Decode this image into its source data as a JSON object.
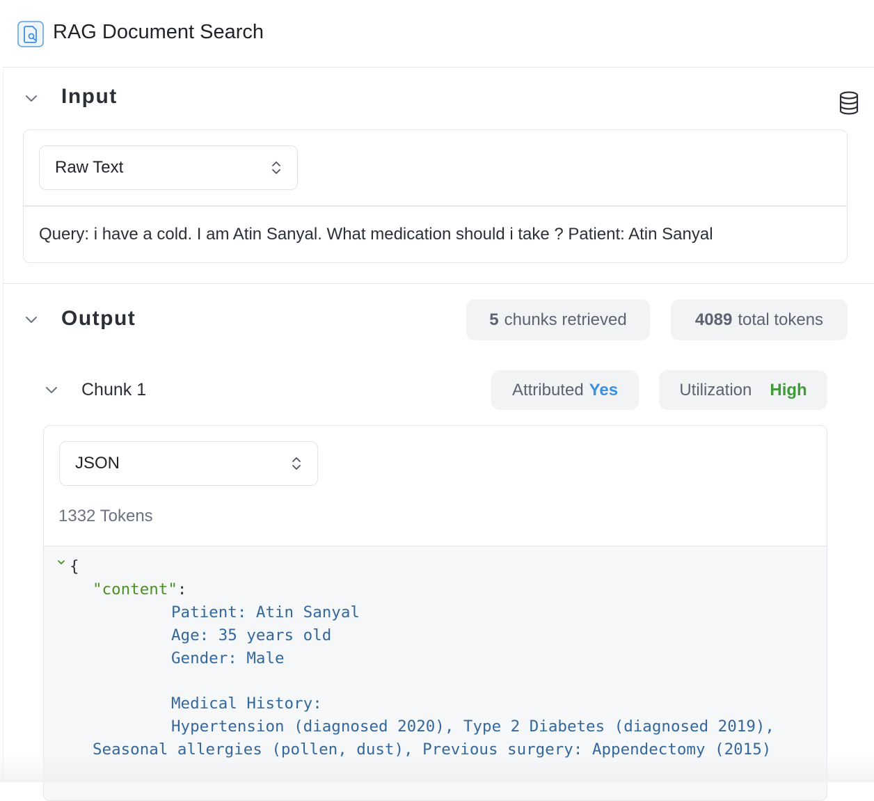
{
  "header": {
    "title": "RAG Document Search",
    "icon": "document-search-icon"
  },
  "input": {
    "title": "Input",
    "format_select": {
      "value": "Raw Text"
    },
    "query_text": "Query: i have a cold. I am Atin Sanyal. What medication should i take ? Patient: Atin Sanyal"
  },
  "output": {
    "title": "Output",
    "chunks_count": "5",
    "chunks_label": "chunks retrieved",
    "tokens_count": "4089",
    "tokens_label": "total tokens",
    "chunk": {
      "title": "Chunk 1",
      "attributed_label": "Attributed",
      "attributed_value": "Yes",
      "utilization_label": "Utilization",
      "utilization_value": "High",
      "format_select": {
        "value": "JSON"
      },
      "tokens": "1332 Tokens",
      "json": {
        "open_brace": "{",
        "key": "\"content\"",
        "colon": ":",
        "lines": [
          "Patient: Atin Sanyal",
          "Age: 35 years old",
          "Gender: Male",
          "",
          "Medical History:",
          "Hypertension (diagnosed 2020), Type 2 Diabetes (diagnosed 2019),",
          "Seasonal allergies (pollen, dust), Previous surgery: Appendectomy (2015)"
        ]
      }
    }
  },
  "colors": {
    "accent_blue": "#3d8fe0",
    "accent_green": "#3f9a3a",
    "json_key": "#4c8f23",
    "json_value": "#34689c"
  }
}
